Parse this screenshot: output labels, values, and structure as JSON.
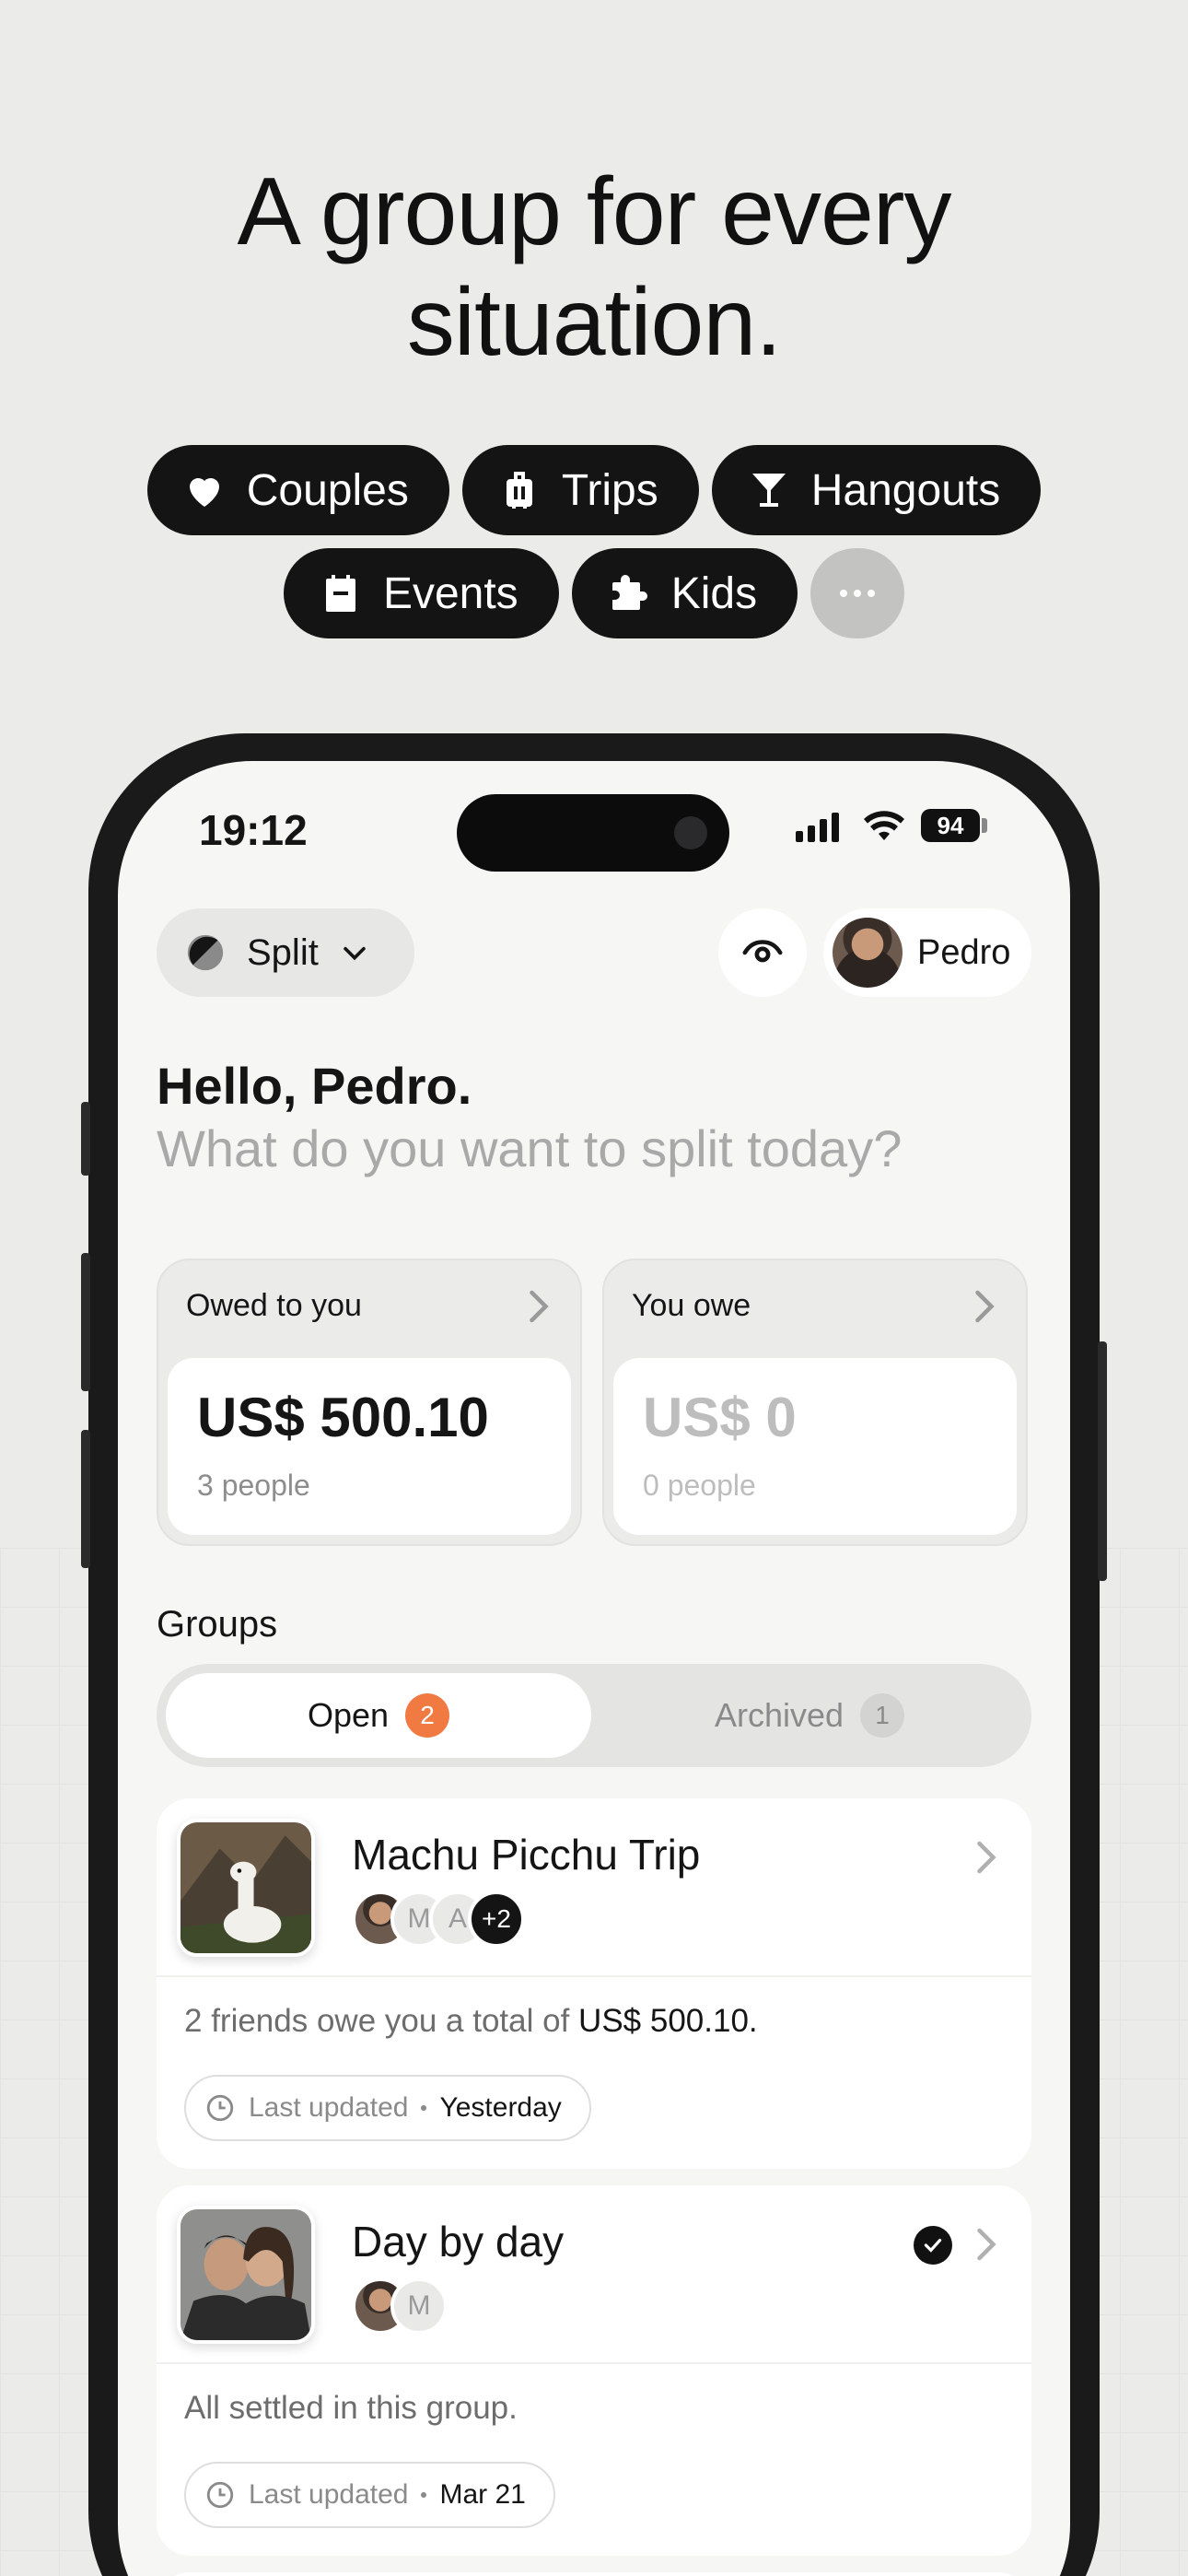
{
  "headline": {
    "line1": "A group for every",
    "line2": "situation."
  },
  "chips": {
    "couples": "Couples",
    "trips": "Trips",
    "hangouts": "Hangouts",
    "events": "Events",
    "kids": "Kids"
  },
  "status": {
    "time": "19:12",
    "battery": "94"
  },
  "topbar": {
    "split_label": "Split",
    "user_name": "Pedro"
  },
  "greeting": {
    "hello": "Hello, Pedro.",
    "question": "What do you want to split today?"
  },
  "owed_to_you": {
    "title": "Owed to you",
    "amount": "US$ 500.10",
    "people": "3 people"
  },
  "you_owe": {
    "title": "You owe",
    "amount": "US$ 0",
    "people": "0 people"
  },
  "groups": {
    "heading": "Groups",
    "tabs": {
      "open_label": "Open",
      "open_count": "2",
      "archived_label": "Archived",
      "archived_count": "1"
    },
    "items": [
      {
        "name": "Machu Picchu Trip",
        "members": [
          "M",
          "A",
          "+2"
        ],
        "summary_prefix": "2 friends owe you a total of ",
        "summary_amount": "US$ 500.10.",
        "updated_label": "Last updated",
        "updated_value": "Yesterday"
      },
      {
        "name": "Day by day",
        "members": [
          "M"
        ],
        "summary_prefix": "All settled in this group.",
        "updated_label": "Last updated",
        "updated_value": "Mar 21"
      }
    ]
  },
  "colors": {
    "accent": "#f07a42",
    "chip_bg": "#141414",
    "page_bg": "#ebebea"
  }
}
